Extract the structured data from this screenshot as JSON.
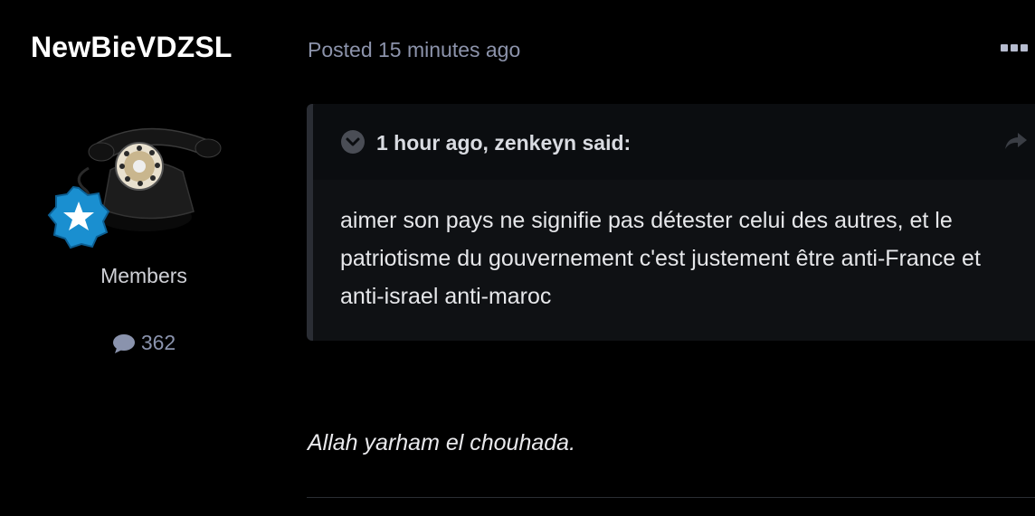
{
  "author": {
    "name": "NewBieVDZSL",
    "group": "Members",
    "post_count": "362",
    "avatar_icon": "rotary-telephone-avatar",
    "badge_icon": "star-rank-badge-icon",
    "badge_color": "#1a8fd0"
  },
  "post": {
    "meta": "Posted 15 minutes ago",
    "menu_icon": "more-options-icon",
    "quote": {
      "citation": "1 hour ago, zenkeyn said:",
      "body": "aimer son pays ne signifie pas détester celui des autres, et le patriotisme du gouvernement c'est justement être anti-France et anti-israel anti-maroc",
      "toggle_icon": "chevron-down-circle-icon",
      "share_icon": "share-arrow-icon"
    },
    "text": "Allah yarham el chouhada."
  },
  "colors": {
    "background": "#000000",
    "quote_bg": "#0f1114",
    "quote_border": "#2a2d34",
    "muted_text": "#8c93ab"
  }
}
